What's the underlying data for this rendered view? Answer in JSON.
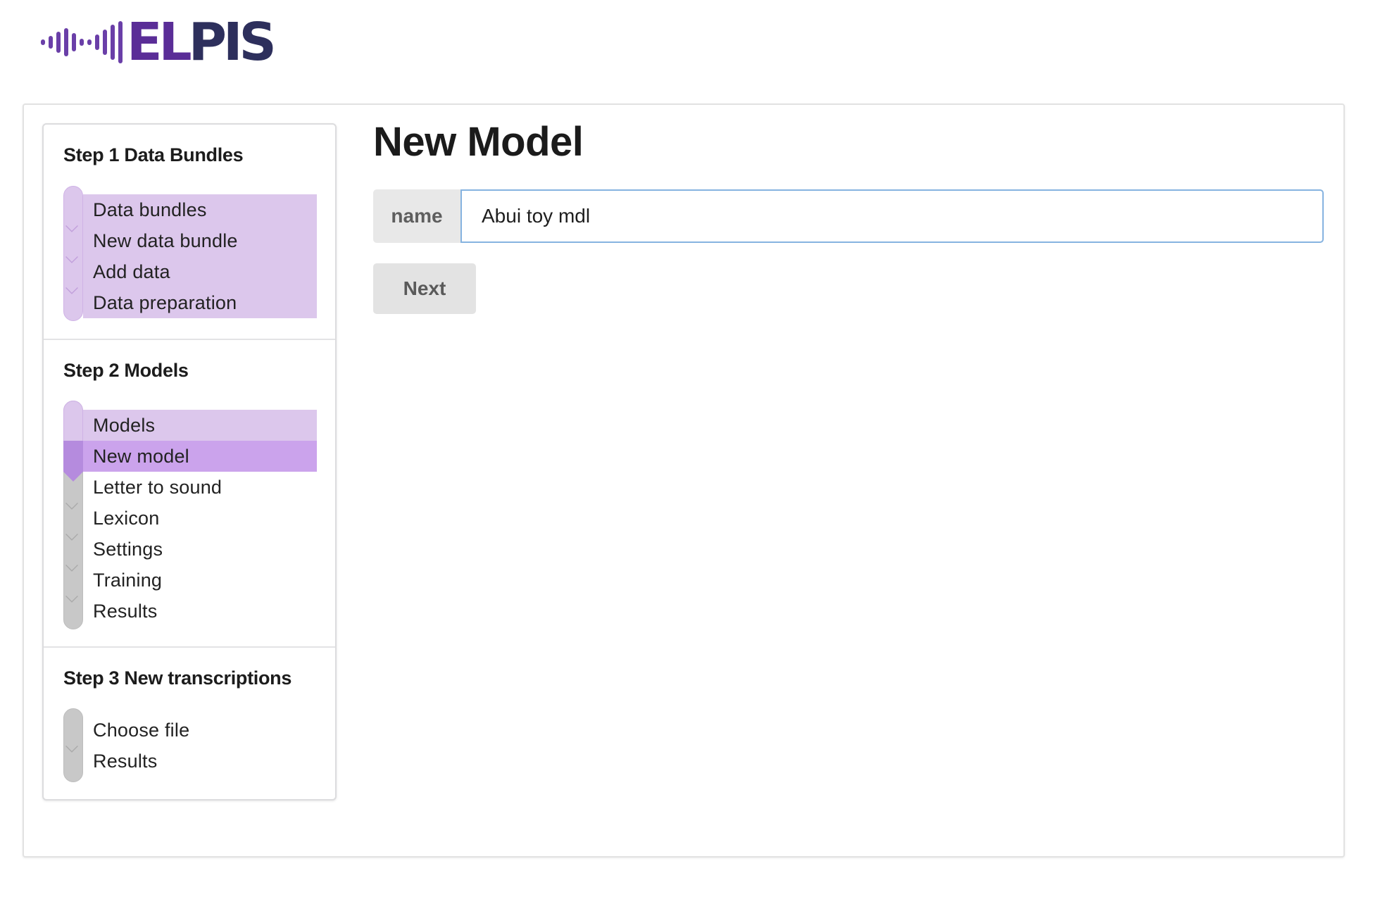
{
  "brand": {
    "logo_letters_a": "EL",
    "logo_letters_b": "PIS",
    "logo_icon": "waveform-bars-icon",
    "colors": {
      "primary_purple": "#5a2d97",
      "dark_navy": "#2d2f5c"
    }
  },
  "sidebar": {
    "steps": [
      {
        "title": "Step 1 Data Bundles",
        "items": [
          {
            "label": "Data bundles",
            "state": "done"
          },
          {
            "label": "New data bundle",
            "state": "done"
          },
          {
            "label": "Add data",
            "state": "done"
          },
          {
            "label": "Data preparation",
            "state": "done"
          }
        ]
      },
      {
        "title": "Step 2 Models",
        "items": [
          {
            "label": "Models",
            "state": "done"
          },
          {
            "label": "New model",
            "state": "active"
          },
          {
            "label": "Letter to sound",
            "state": "todo"
          },
          {
            "label": "Lexicon",
            "state": "todo"
          },
          {
            "label": "Settings",
            "state": "todo"
          },
          {
            "label": "Training",
            "state": "todo"
          },
          {
            "label": "Results",
            "state": "todo"
          }
        ]
      },
      {
        "title": "Step 3 New transcriptions",
        "items": [
          {
            "label": "Choose file",
            "state": "todo"
          },
          {
            "label": "Results",
            "state": "todo"
          }
        ]
      }
    ],
    "colors": {
      "done": "#dcc7ec",
      "active": "#cba3ec",
      "todo": "#c8c8c8"
    }
  },
  "main": {
    "title": "New Model",
    "form": {
      "name_label": "name",
      "name_value": "Abui toy mdl"
    },
    "next_label": "Next"
  }
}
